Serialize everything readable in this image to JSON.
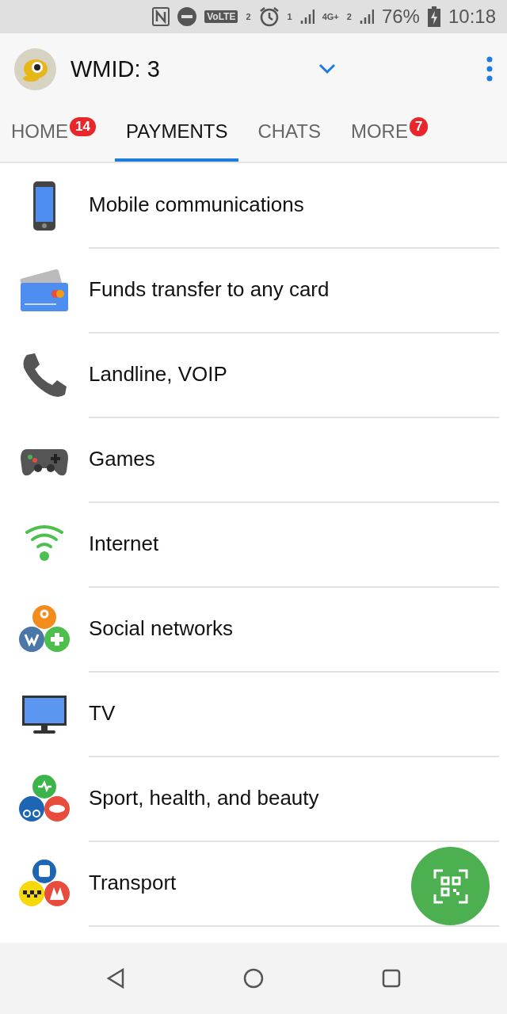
{
  "status_bar": {
    "volte": "VoLTE",
    "volte_sim": "2",
    "sim1": "1",
    "network": "4G+",
    "sim2": "2",
    "battery": "76%",
    "time": "10:18"
  },
  "header": {
    "wmid": "WMID: 3"
  },
  "tabs": [
    {
      "label": "HOME",
      "badge": "14",
      "selected": false
    },
    {
      "label": "PAYMENTS",
      "selected": true
    },
    {
      "label": "CHATS",
      "selected": false
    },
    {
      "label": "MORE",
      "badge": "7",
      "selected": false
    }
  ],
  "categories": [
    {
      "kind": "mobile",
      "label": "Mobile communications"
    },
    {
      "kind": "card",
      "label": "Funds transfer to any card"
    },
    {
      "kind": "landline",
      "label": "Landline, VOIP"
    },
    {
      "kind": "games",
      "label": "Games"
    },
    {
      "kind": "internet",
      "label": "Internet"
    },
    {
      "kind": "social",
      "label": "Social networks"
    },
    {
      "kind": "tv",
      "label": "TV"
    },
    {
      "kind": "sport",
      "label": "Sport, health, and beauty"
    },
    {
      "kind": "transport",
      "label": "Transport"
    }
  ]
}
